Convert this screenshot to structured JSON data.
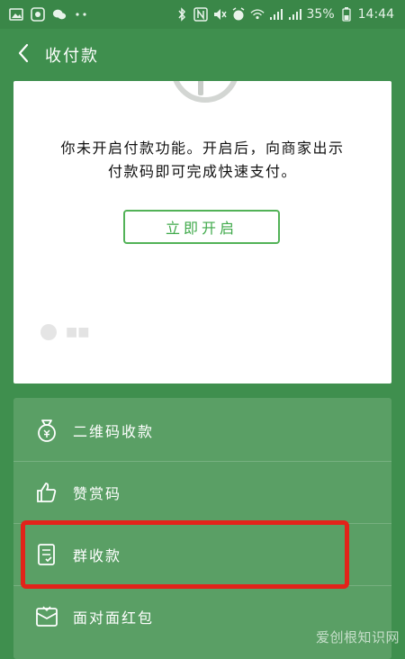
{
  "status_bar": {
    "battery": "35%",
    "time": "14:44"
  },
  "header": {
    "title": "收付款"
  },
  "card": {
    "message_line1": "你未开启付款功能。开启后，向商家出示",
    "message_line2": "付款码即可完成快速支付。",
    "enable_button": "立即开启"
  },
  "menu": {
    "items": [
      {
        "label": "二维码收款",
        "icon": "money-bag-icon"
      },
      {
        "label": "赞赏码",
        "icon": "thumbs-up-icon"
      },
      {
        "label": "群收款",
        "icon": "group-collection-icon",
        "highlighted": true
      },
      {
        "label": "面对面红包",
        "icon": "red-envelope-icon"
      }
    ]
  },
  "colors": {
    "background": "#3f8f4e",
    "panel": "#5a9f65",
    "accent_green": "#3fa94a",
    "highlight_red": "#e2231a"
  },
  "watermark": {
    "text": "爱创根知识网"
  }
}
